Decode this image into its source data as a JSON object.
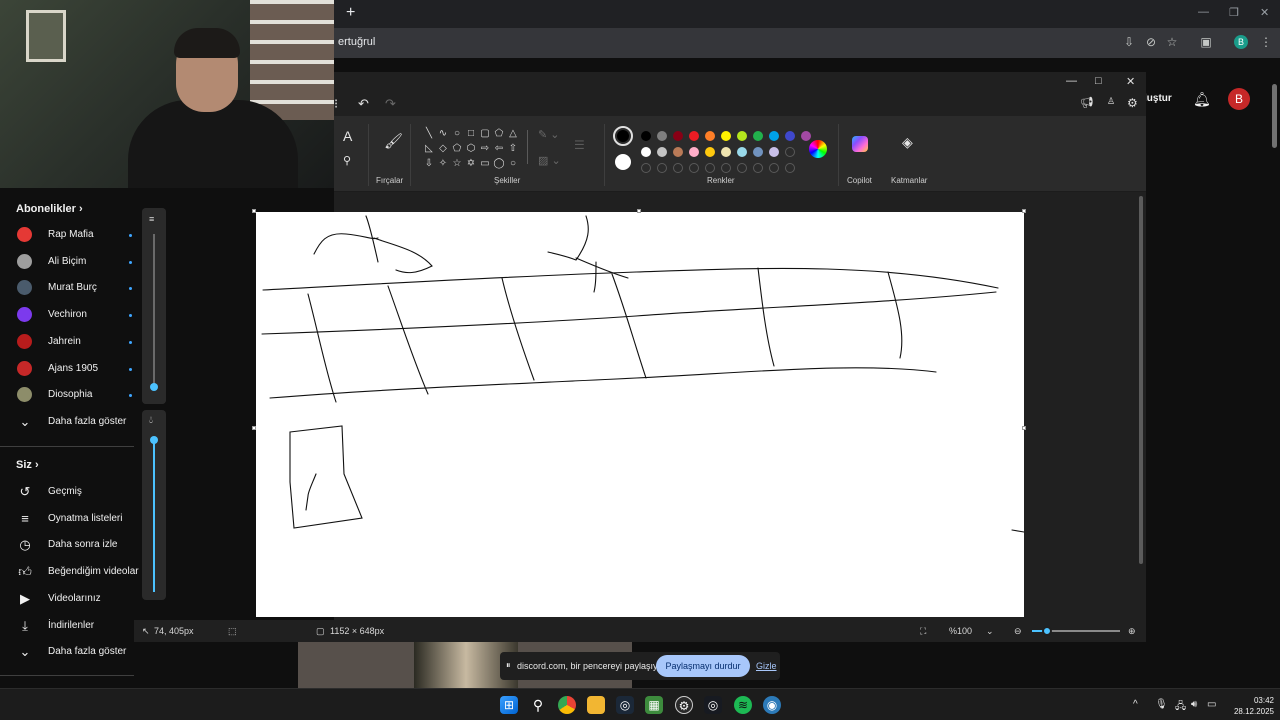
{
  "browser": {
    "newtab_label": "+",
    "address_text": "ertuğrul",
    "profile_initial": "B"
  },
  "youtube": {
    "create_label": "luştur",
    "avatar_initial": "B",
    "subscriptions_header": "Abonelikler",
    "subscriptions": [
      {
        "label": "Rap Mafia",
        "color": "#e53935"
      },
      {
        "label": "Ali Biçim",
        "color": "#9e9e9e"
      },
      {
        "label": "Murat Burç",
        "color": "#4a5b6c"
      },
      {
        "label": "Vechiron",
        "color": "#7c3aed"
      },
      {
        "label": "Jahrein",
        "color": "#b71c1c"
      },
      {
        "label": "Ajans 1905",
        "color": "#c62828"
      },
      {
        "label": "Diosophia",
        "color": "#8d8d6a"
      }
    ],
    "show_more_1": "Daha fazla göster",
    "you_header": "Siz",
    "you_items": [
      {
        "label": "Geçmiş",
        "icon": "history-icon"
      },
      {
        "label": "Oynatma listeleri",
        "icon": "playlist-icon"
      },
      {
        "label": "Daha sonra izle",
        "icon": "clock-icon"
      },
      {
        "label": "Beğendiğim videolar",
        "icon": "thumbs-up-icon"
      },
      {
        "label": "Videolarınız",
        "icon": "video-icon"
      },
      {
        "label": "İndirilenler",
        "icon": "download-icon"
      }
    ],
    "show_more_2": "Daha fazla göster"
  },
  "paint": {
    "ribbon": {
      "brushes_label": "Fırçalar",
      "shapes_label": "Şekiller",
      "colors_label": "Renkler",
      "copilot_label": "Copilot",
      "layers_label": "Katmanlar"
    },
    "palette_row1": [
      "#000000",
      "#7f7f7f",
      "#880015",
      "#ed1c24",
      "#ff7f27",
      "#fff200",
      "#b5e61d",
      "#22b14c",
      "#00a2e8",
      "#3f48cc",
      "#a349a4"
    ],
    "palette_row2": [
      "#ffffff",
      "#c3c3c3",
      "#b97a57",
      "#ffaec9",
      "#ffc90e",
      "#efe4b0",
      "#99d9ea",
      "#7092be",
      "#c8bfe7"
    ],
    "status": {
      "cursor_pos": "74, 405px",
      "canvas_size": "1152 × 648px",
      "zoom": "%100"
    }
  },
  "share": {
    "text": "discord.com, bir pencereyi paylaşıyor.",
    "stop_label": "Paylaşmayı durdur",
    "hide_label": "Gizle"
  },
  "taskbar": {
    "time": "03:42",
    "date": "28.12.2025"
  }
}
